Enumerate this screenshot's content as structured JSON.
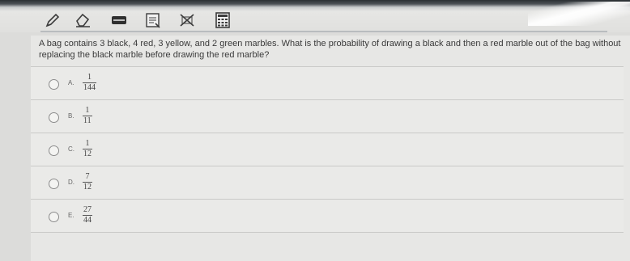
{
  "toolbar": {
    "tools": [
      {
        "icon": "pencil-icon"
      },
      {
        "icon": "eraser-icon"
      },
      {
        "icon": "highlighter-icon"
      },
      {
        "icon": "notepad-icon"
      },
      {
        "icon": "eliminate-icon"
      },
      {
        "icon": "calculator-icon"
      }
    ]
  },
  "question": {
    "text": "A bag contains 3 black, 4 red, 3 yellow, and 2 green marbles. What is the probability of drawing a black and then a red marble out of the bag without replacing the black marble before drawing the red marble?"
  },
  "options": [
    {
      "letter": "A.",
      "numerator": "1",
      "denominator": "144"
    },
    {
      "letter": "B.",
      "numerator": "1",
      "denominator": "11"
    },
    {
      "letter": "C.",
      "numerator": "1",
      "denominator": "12"
    },
    {
      "letter": "D.",
      "numerator": "7",
      "denominator": "12"
    },
    {
      "letter": "E.",
      "numerator": "27",
      "denominator": "44"
    }
  ],
  "colors": {
    "panel": "#e7e7e5",
    "text": "#3a3a3a",
    "divider": "#c9c9c7"
  }
}
